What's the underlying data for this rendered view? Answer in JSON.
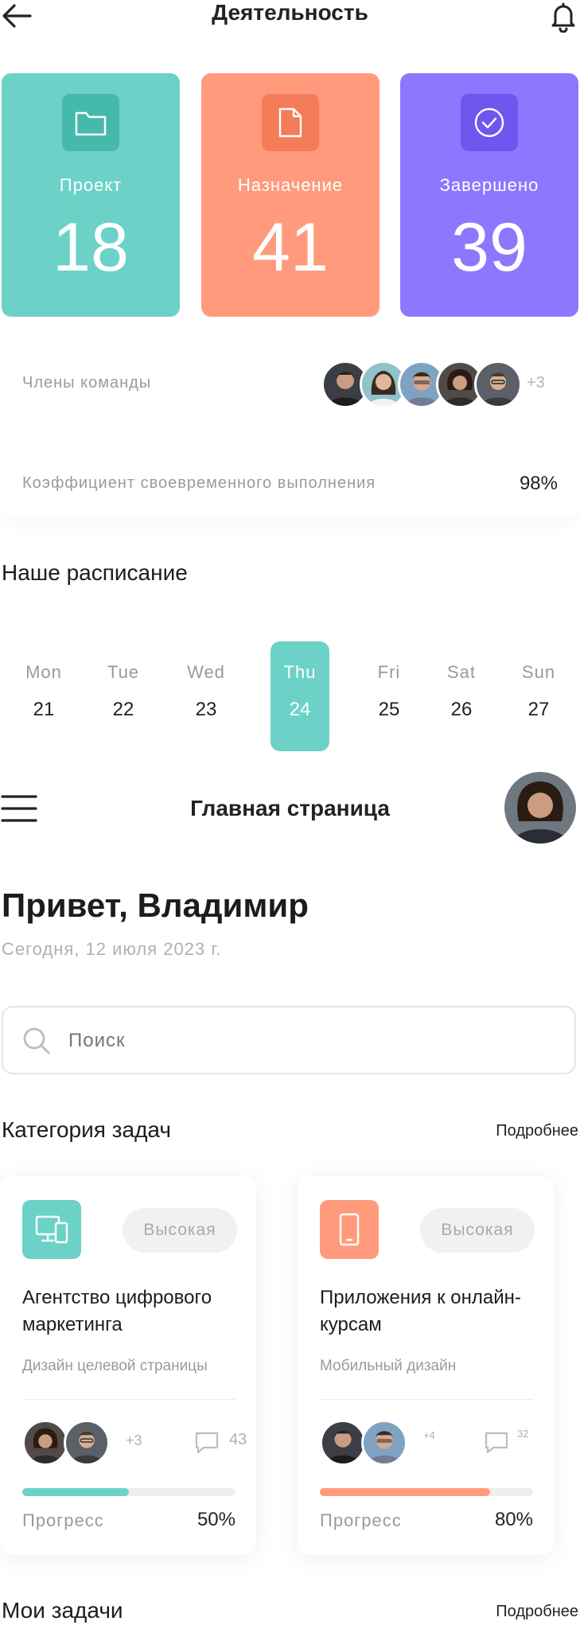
{
  "header": {
    "title": "Деятельность"
  },
  "stats": [
    {
      "label": "Проект",
      "value": "18",
      "color": "#6cd2c7",
      "icon_color": "#46b9ad",
      "icon": "folder-icon"
    },
    {
      "label": "Назначение",
      "value": "41",
      "color": "#ff9b7c",
      "icon_color": "#f47c58",
      "icon": "document-icon"
    },
    {
      "label": "Завершено",
      "value": "39",
      "color": "#8b78ff",
      "icon_color": "#6e57ef",
      "icon": "check-circle-icon"
    }
  ],
  "team": {
    "label": "Члены команды",
    "extra": "+3"
  },
  "rate": {
    "label": "Коэффициент своевременного выполнения",
    "value": "98%"
  },
  "schedule": {
    "title": "Наше расписание",
    "days": [
      {
        "name": "Mon",
        "num": "21"
      },
      {
        "name": "Tue",
        "num": "22"
      },
      {
        "name": "Wed",
        "num": "23"
      },
      {
        "name": "Thu",
        "num": "24",
        "active": true
      },
      {
        "name": "Fri",
        "num": "25"
      },
      {
        "name": "Sat",
        "num": "26"
      },
      {
        "name": "Sun",
        "num": "27"
      }
    ]
  },
  "home": {
    "title": "Главная страница",
    "greeting": "Привет, Владимир",
    "date": "Сегодня, 12 июля 2023 г."
  },
  "search": {
    "placeholder": "Поиск"
  },
  "categories": {
    "title": "Категория задач",
    "more": "Подробнее",
    "cards": [
      {
        "badge": "Высокая",
        "title": "Агентство цифрового маркетинга",
        "subtitle": "Дизайн целевой страницы",
        "extra": "+3",
        "comments": "43",
        "progress_label": "Прогресс",
        "progress": "50%",
        "progress_value": 0.5,
        "color": "#6cd2c7",
        "icon": "devices-icon"
      },
      {
        "badge": "Высокая",
        "title": "Приложения к онлайн-курсам",
        "subtitle": "Мобильный дизайн",
        "extra": "+4",
        "comments": "32",
        "progress_label": "Прогресс",
        "progress": "80%",
        "progress_value": 0.8,
        "color": "#ff9b7c",
        "icon": "phone-icon"
      }
    ]
  },
  "my_tasks": {
    "title": "Мои задачи",
    "more": "Подробнее"
  }
}
